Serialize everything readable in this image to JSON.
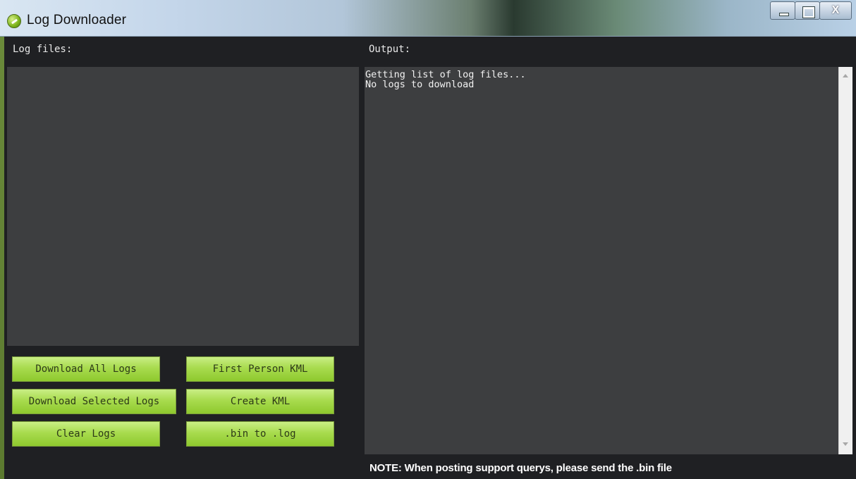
{
  "window": {
    "title": "Log Downloader",
    "app_icon": "mission-planner-icon",
    "controls": {
      "minimize": "minimize-icon",
      "maximize": "maximize-icon",
      "close_glyph": "X"
    }
  },
  "labels": {
    "log_files": "Log files:",
    "output": "Output:"
  },
  "output": {
    "text": "Getting list of log files...\nNo logs to download"
  },
  "buttons": {
    "download_all": "Download All Logs",
    "first_person_kml": "First Person KML",
    "download_selected": "Download Selected Logs",
    "create_kml": "Create KML",
    "clear_logs": "Clear Logs",
    "bin_to_log": ".bin to .log"
  },
  "note": "NOTE: When posting support querys, please send the .bin file",
  "colors": {
    "background": "#1f2023",
    "panel": "#3d3e40",
    "button_green": "#a8db4e",
    "text": "#e8e8e8"
  }
}
